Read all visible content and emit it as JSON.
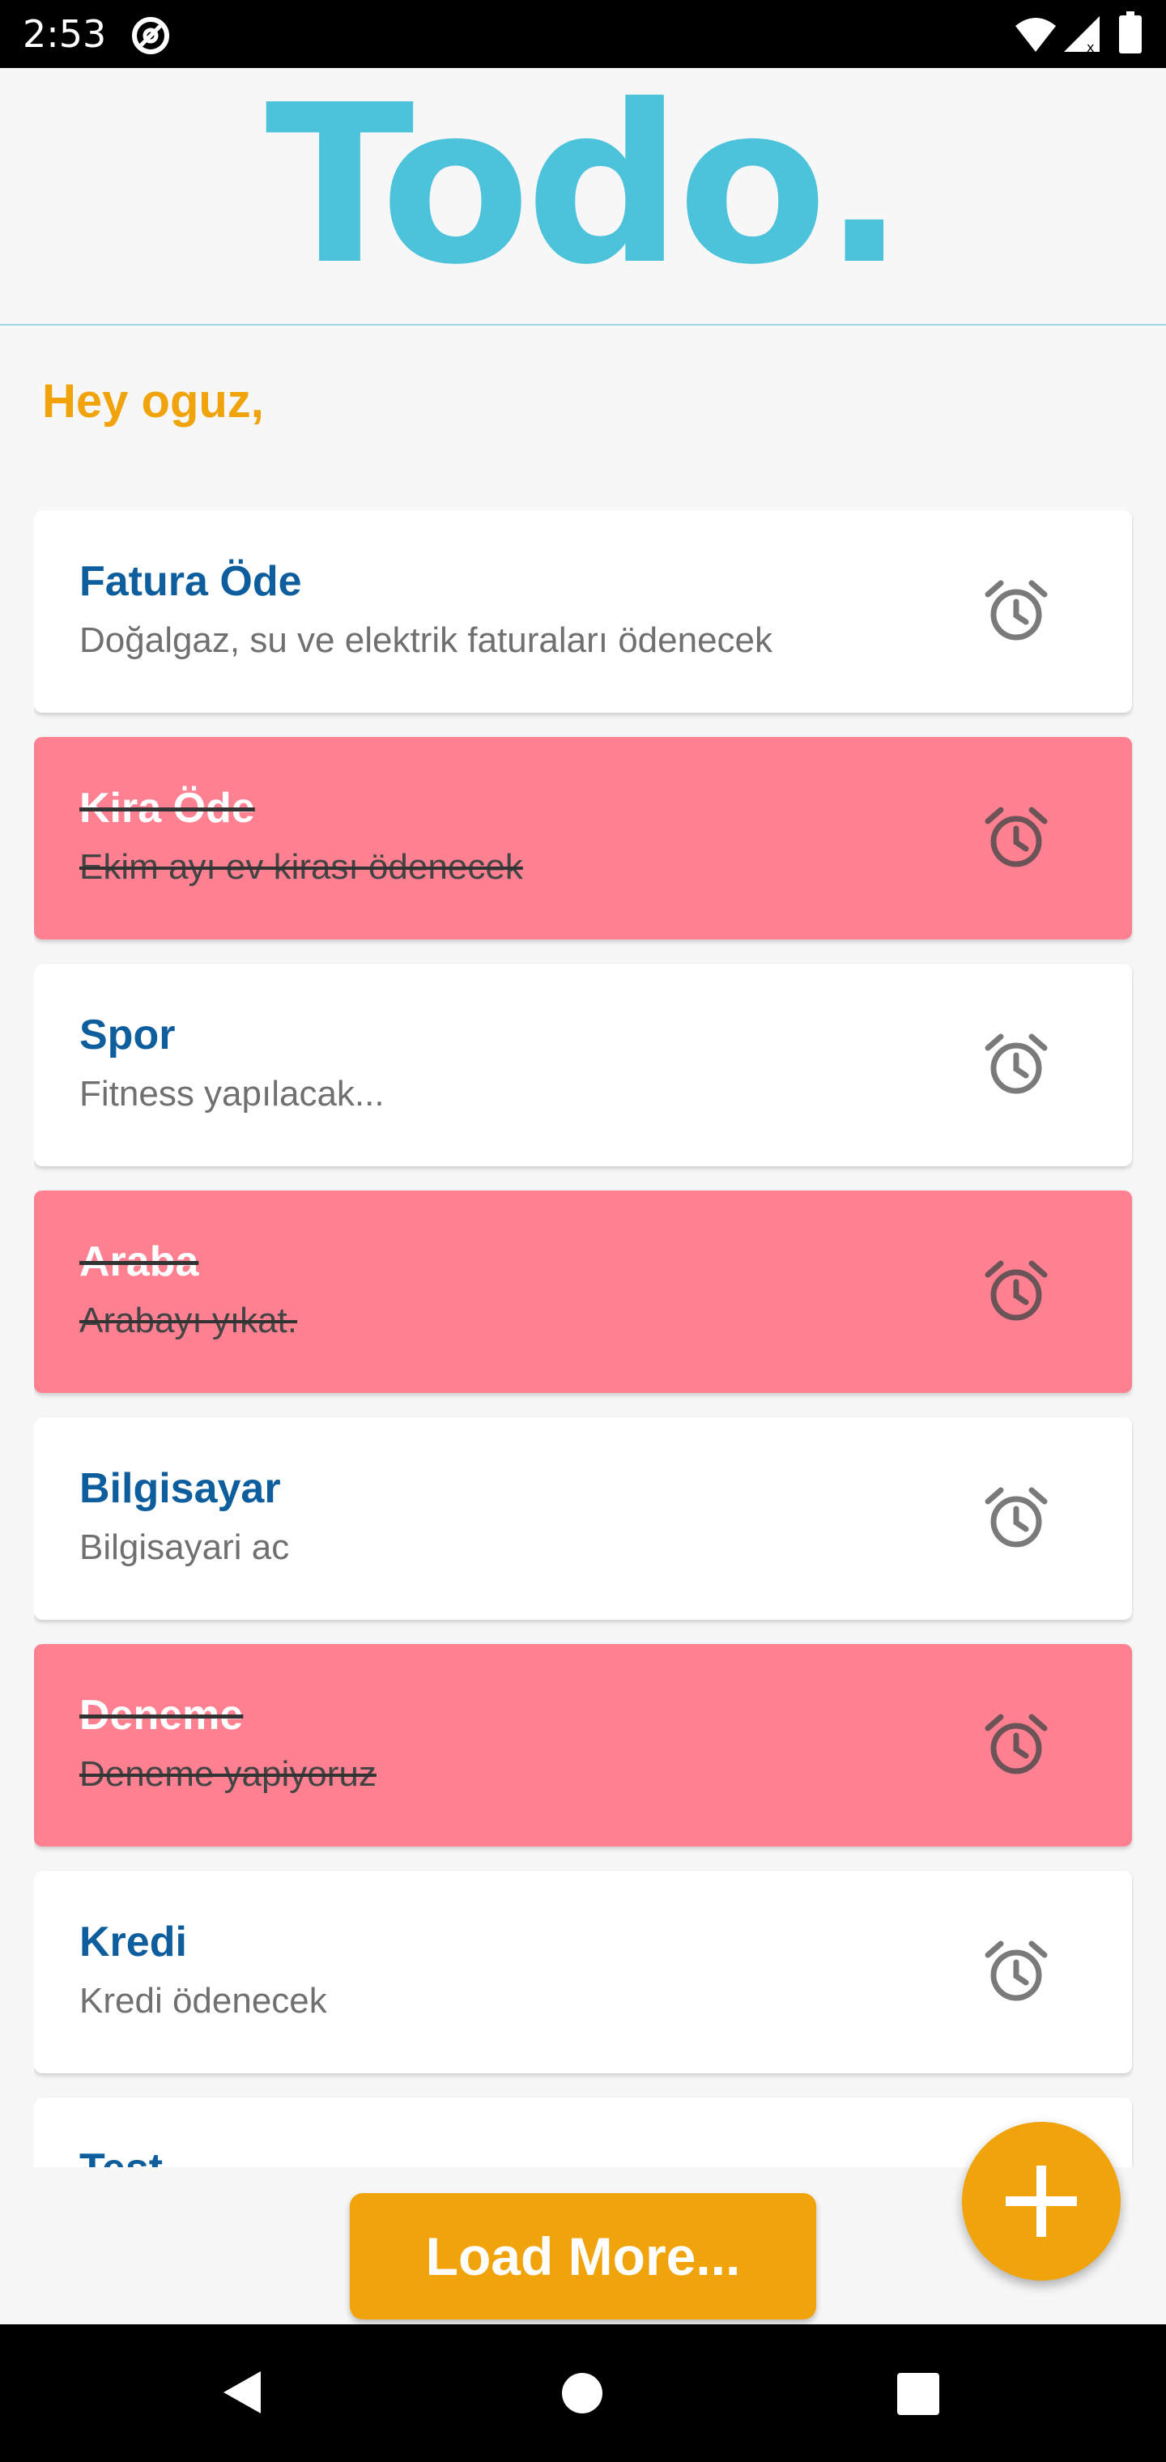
{
  "status_bar": {
    "time": "2:53",
    "icons": [
      "at-icon",
      "wifi-icon",
      "signal-icon",
      "battery-icon"
    ]
  },
  "header": {
    "logo": "Todo."
  },
  "greeting": "Hey oguz,",
  "todos": [
    {
      "title": "Fatura Öde",
      "description": "Doğalgaz, su ve elektrik faturaları ödenecek",
      "done": false
    },
    {
      "title": "Kira Öde",
      "description": "Ekim ayı ev kirası ödenecek",
      "done": true
    },
    {
      "title": "Spor",
      "description": "Fitness yapılacak...",
      "done": false
    },
    {
      "title": "Araba",
      "description": "Arabayı yıkat.",
      "done": true
    },
    {
      "title": "Bilgisayar",
      "description": "Bilgisayari ac",
      "done": false
    },
    {
      "title": "Deneme",
      "description": "Deneme yapiyoruz",
      "done": true
    },
    {
      "title": "Kredi",
      "description": "Kredi ödenecek",
      "done": false
    },
    {
      "title": "Test",
      "description": "",
      "done": false
    }
  ],
  "load_more_label": "Load More...",
  "colors": {
    "logo": "#4cc3db",
    "accent": "#f0a30a",
    "title": "#0e5e9e",
    "done_card": "#ff8090",
    "card": "#ffffff"
  }
}
